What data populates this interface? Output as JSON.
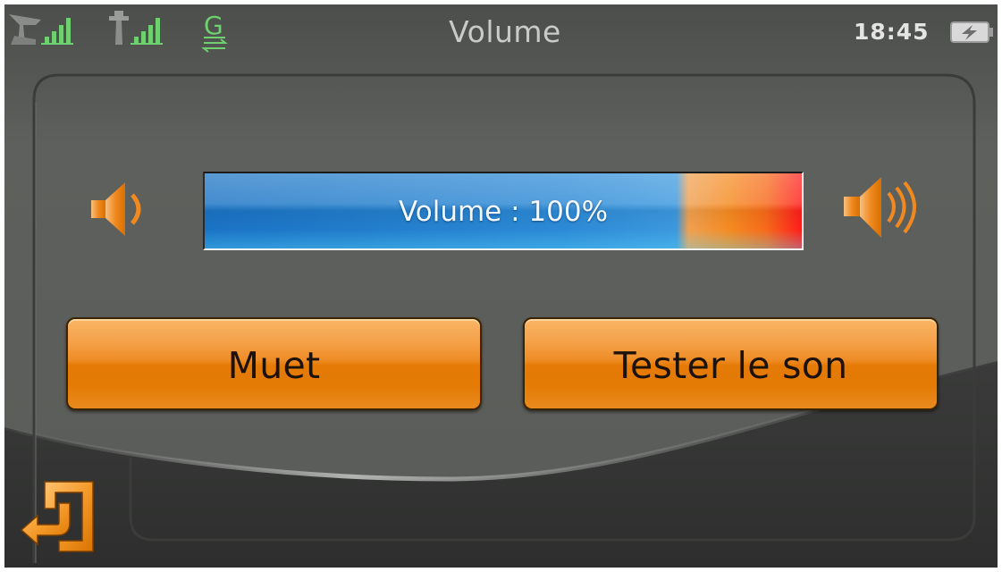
{
  "screen": {
    "title": "Volume",
    "time": "18:45"
  },
  "status_icons": [
    {
      "name": "satellite-signal-icon",
      "level": "4 of 4 bars"
    },
    {
      "name": "gsm-signal-icon",
      "level": "4 of 4 bars"
    },
    {
      "name": "gprs-g-icon"
    },
    {
      "name": "battery-charging-icon"
    }
  ],
  "volume": {
    "label": "Volume : 100%",
    "level": 1.0
  },
  "buttons": {
    "mute": "Muet",
    "test_sound": "Tester le son"
  },
  "icons": {
    "speaker_low": "speaker-low-icon",
    "speaker_high": "speaker-high-icon",
    "back": "back-arrow-icon"
  },
  "colors": {
    "accent": "#e57a06",
    "title_text": "#c9cbc9",
    "signal": "#6fd06f",
    "panel": "#5b5d5a",
    "volume_blue": "#2c8ad6",
    "volume_red": "#ff1c1c"
  }
}
